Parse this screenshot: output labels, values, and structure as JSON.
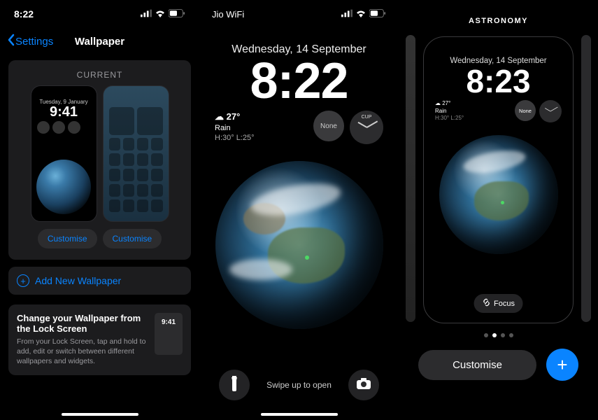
{
  "panel1": {
    "status_time": "8:22",
    "back_label": "Settings",
    "title": "Wallpaper",
    "current_label": "CURRENT",
    "lock_preview": {
      "date": "Tuesday, 9 January",
      "time": "9:41"
    },
    "customise_lock": "Customise",
    "customise_home": "Customise",
    "add_new": "Add New Wallpaper",
    "info_title": "Change your Wallpaper from the Lock Screen",
    "info_body": "From your Lock Screen, tap and hold to add, edit or switch between different wallpapers and widgets.",
    "info_preview_time": "9:41"
  },
  "panel2": {
    "carrier": "Jio WiFi",
    "date": "Wednesday, 14 September",
    "time": "8:22",
    "weather": {
      "temp": "27°",
      "cond": "Rain",
      "hilow": "H:30° L:25°"
    },
    "widget_none": "None",
    "clock_label": "CUP",
    "swipe": "Swipe up to open"
  },
  "panel3": {
    "category": "ASTRONOMY",
    "date": "Wednesday, 14 September",
    "time": "8:23",
    "weather": {
      "temp": "27°",
      "cond": "Rain",
      "hilow": "H:30° L:25°"
    },
    "widget_none": "None",
    "focus": "Focus",
    "customise": "Customise"
  }
}
